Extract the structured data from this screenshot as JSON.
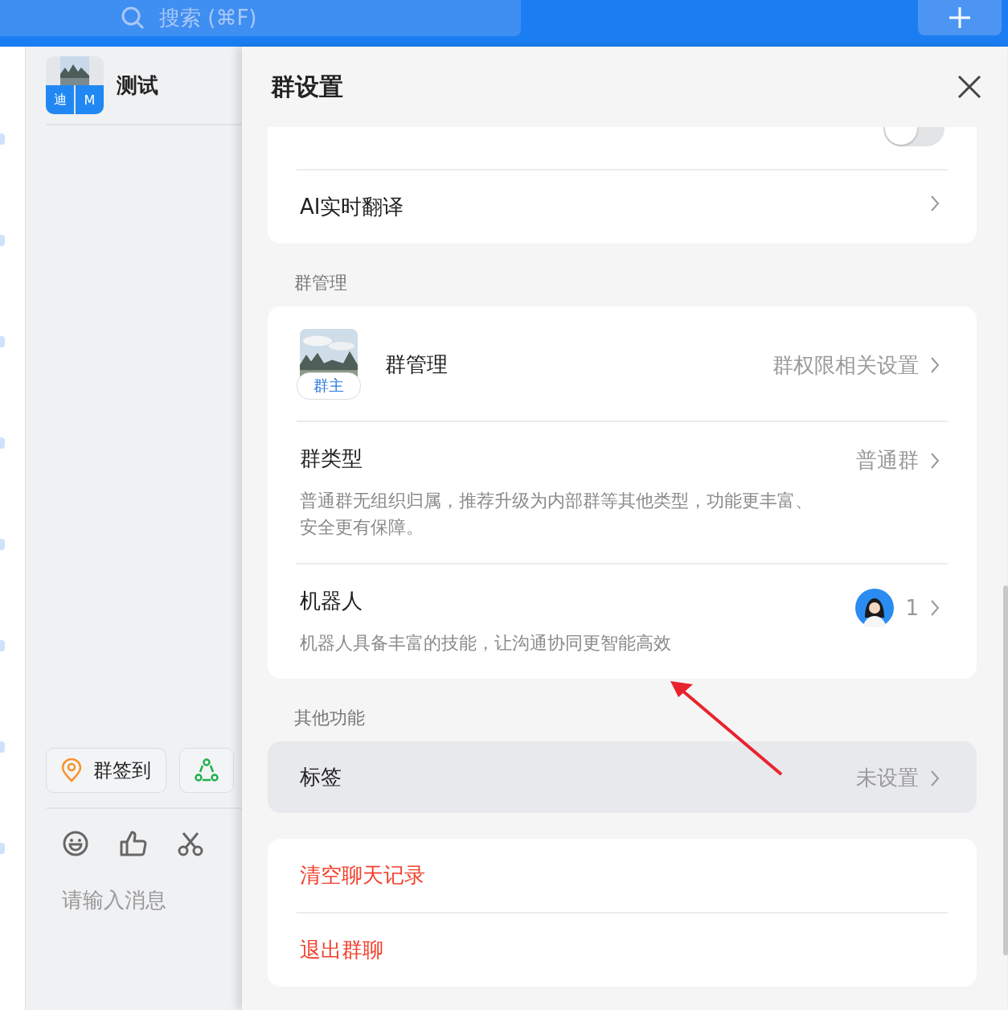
{
  "top_bar": {
    "search": {
      "placeholder": "搜索 (⌘F)"
    }
  },
  "chat": {
    "group_name": "测试",
    "avatar_tiles": [
      "迪",
      "M"
    ],
    "shortcuts": [
      {
        "kind": "checkin",
        "label": "群签到"
      },
      {
        "kind": "circle"
      }
    ],
    "input": {
      "placeholder": "请输入消息"
    }
  },
  "panel": {
    "title": "群设置",
    "cards": [
      {
        "rows": [
          {
            "kind": "toggle",
            "on": false
          },
          {
            "kind": "link",
            "label": "AI实时翻译"
          }
        ]
      },
      {
        "heading": "群管理",
        "rows": [
          {
            "kind": "admin",
            "label": "群管理",
            "badge": "群主",
            "value": "群权限相关设置"
          },
          {
            "kind": "link",
            "label": "群类型",
            "value": "普通群",
            "description": "普通群无组织归属，推荐升级为内部群等其他类型，功能更丰富、安全更有保障。"
          },
          {
            "kind": "robot",
            "label": "机器人",
            "count": "1",
            "description": "机器人具备丰富的技能，让沟通协同更智能高效"
          }
        ]
      },
      {
        "heading": "其他功能",
        "rows": [
          {
            "kind": "link",
            "label": "标签",
            "value": "未设置",
            "hovered": true
          }
        ]
      },
      {
        "rows": [
          {
            "kind": "danger",
            "label": "清空聊天记录"
          },
          {
            "kind": "danger",
            "label": "退出群聊"
          }
        ]
      }
    ]
  }
}
